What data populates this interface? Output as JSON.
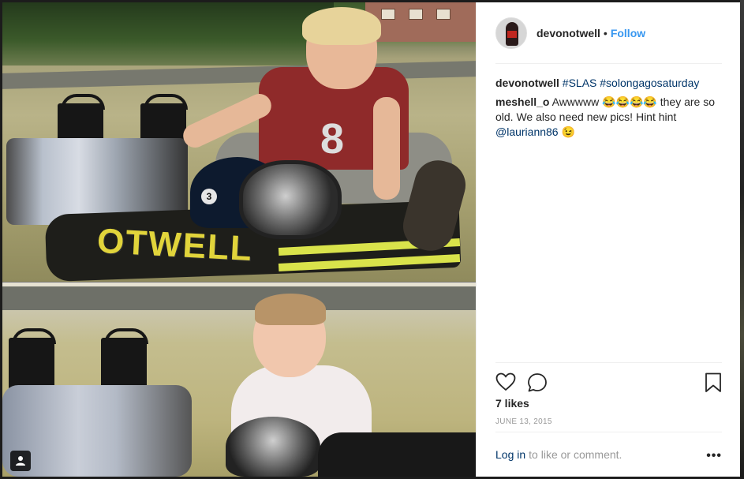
{
  "post": {
    "photo_text": "OTWELL",
    "shirt_number": "8",
    "helmet_number": "3"
  },
  "header": {
    "username": "devonotwell",
    "separator": "•",
    "follow_label": "Follow"
  },
  "caption": {
    "username": "devonotwell",
    "hashtags": "#SLAS #solongagosaturday"
  },
  "comments": [
    {
      "username": "meshell_o",
      "text": "Awwwww 😂😂😂😂 they are so old. We also need new pics! Hint hint ",
      "mention": "@lauriann86",
      "trailing": " 😉"
    }
  ],
  "actions": {
    "like_icon": "heart-icon",
    "comment_icon": "comment-icon",
    "save_icon": "bookmark-icon"
  },
  "likes": "7 likes",
  "date": "JUNE 13, 2015",
  "footer": {
    "login_label": "Log in",
    "rest_text": "to like or comment.",
    "more_label": "•••"
  },
  "colors": {
    "link": "#3897f0",
    "dark_link": "#003569",
    "muted": "#999999"
  }
}
